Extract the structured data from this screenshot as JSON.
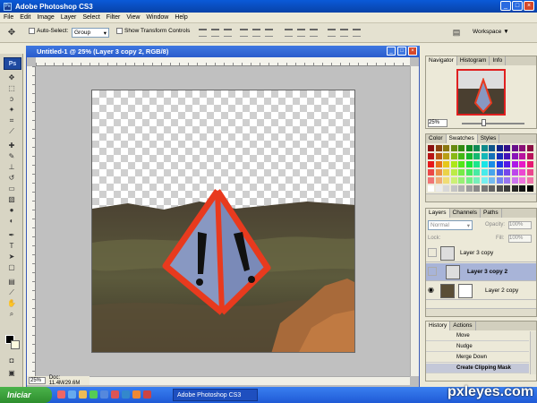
{
  "window": {
    "title": "Adobe Photoshop CS3"
  },
  "menu": [
    "File",
    "Edit",
    "Image",
    "Layer",
    "Select",
    "Filter",
    "View",
    "Window",
    "Help"
  ],
  "options": {
    "auto_select_label": "Auto-Select:",
    "auto_select_value": "Group",
    "show_transform_label": "Show Transform Controls",
    "workspace_label": "Workspace ▼"
  },
  "toolbox": {
    "logo": "Ps"
  },
  "document": {
    "title": "Untitled-1 @ 25% (Layer 3 copy 2, RGB/8)",
    "zoom": "25%",
    "doc_info": "Doc: 11.4M/29.6M"
  },
  "navigator": {
    "tabs": [
      "Navigator",
      "Histogram",
      "Info"
    ],
    "zoom": "25%"
  },
  "swatches": {
    "tabs": [
      "Color",
      "Swatches",
      "Styles"
    ]
  },
  "layers": {
    "tabs": [
      "Layers",
      "Channels",
      "Paths"
    ],
    "blend_mode": "Normal",
    "opacity_label": "Opacity:",
    "opacity": "100%",
    "lock_label": "Lock:",
    "fill_label": "Fill:",
    "fill": "100%",
    "rows": [
      {
        "name": "Layer 3 copy",
        "selected": false
      },
      {
        "name": "Layer 3 copy 2",
        "selected": true
      },
      {
        "name": "Layer 2 copy",
        "selected": false
      }
    ]
  },
  "history": {
    "tabs": [
      "History",
      "Actions"
    ],
    "rows": [
      "Move",
      "Nudge",
      "Merge Down",
      "Create Clipping Mask"
    ]
  },
  "taskbar": {
    "start_label": "Iniciar",
    "task_label": "Adobe Photoshop CS3",
    "watermark": "pxleyes.com"
  },
  "colors": {
    "accent": "#0a5ad8",
    "warning_orange": "#e83a1e",
    "warning_fill": "#8a9ac4"
  }
}
